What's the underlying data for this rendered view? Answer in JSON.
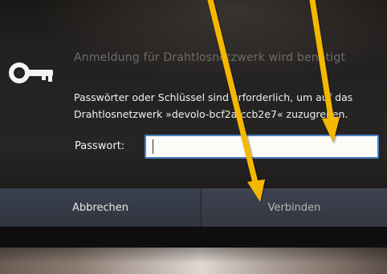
{
  "dialog": {
    "title": "Anmeldung für Drahtlosnetzwerk wird benötigt",
    "message_line1": "Passwörter oder Schlüssel sind erforderlich, um auf das",
    "message_line2": "Drahtlosnetzwerk »devolo-bcf2afccb2e7« zuzugreifen.",
    "password_label": "Passwort:",
    "password_value": "",
    "icon": "key-icon"
  },
  "buttons": {
    "cancel_label": "Abbrechen",
    "connect_label": "Verbinden"
  },
  "annotations": {
    "arrow_color": "#f5b800",
    "arrow_count": 2
  },
  "colors": {
    "dialog_bg": "#262524",
    "input_border": "#4a7fbf",
    "button_bg": "#353944"
  }
}
